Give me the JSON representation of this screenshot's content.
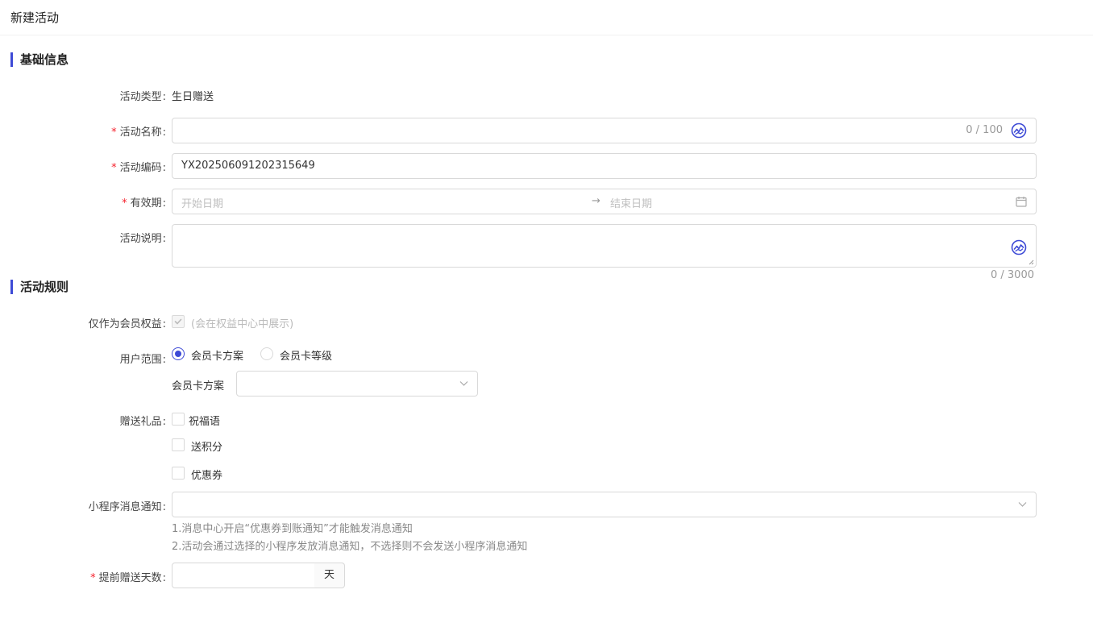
{
  "page_title": "新建活动",
  "sections": {
    "basic": "基础信息",
    "rules": "活动规则"
  },
  "form": {
    "activity_type": {
      "label": "活动类型",
      "value": "生日赠送"
    },
    "activity_name": {
      "label": "活动名称",
      "value": "",
      "counter": "0 / 100",
      "required": true
    },
    "activity_code": {
      "label": "活动编码",
      "value": "YX202506091202315649",
      "required": true
    },
    "validity": {
      "label": "有效期",
      "start_placeholder": "开始日期",
      "end_placeholder": "结束日期",
      "separator": "→",
      "required": true
    },
    "description": {
      "label": "活动说明",
      "value": "",
      "counter": "0 / 3000"
    },
    "member_benefit": {
      "label": "仅作为会员权益",
      "checked": true,
      "disabled": true,
      "note": "(会在权益中心中展示)"
    },
    "user_scope": {
      "label": "用户范围",
      "options": [
        "会员卡方案",
        "会员卡等级"
      ],
      "selected": "会员卡方案",
      "sub_label": "会员卡方案",
      "sub_value": ""
    },
    "gifts": {
      "label": "赠送礼品",
      "options": [
        "祝福语",
        "送积分",
        "优惠券"
      ]
    },
    "mini_notice": {
      "label": "小程序消息通知",
      "value": "",
      "hints": [
        "1.消息中心开启“优惠券到账通知”才能触发消息通知",
        "2.活动会通过选择的小程序发放消息通知，不选择则不会发送小程序消息通知"
      ]
    },
    "advance_days": {
      "label": "提前赠送天数",
      "value": "",
      "unit": "天",
      "required": true
    }
  },
  "colors": {
    "accent": "#3d4ad6",
    "required": "#f5222d",
    "border": "#d9d9d9"
  },
  "icons": [
    "ai-assist-icon",
    "calendar-icon",
    "chevron-down-icon",
    "check-icon",
    "arrow-right-icon"
  ]
}
